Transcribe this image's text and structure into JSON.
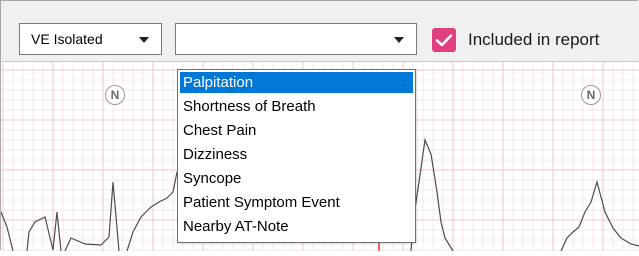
{
  "toolbar": {
    "beat_type_select": {
      "value": "VE Isolated"
    },
    "symptom_select": {
      "value": ""
    },
    "include_checkbox": {
      "checked": true,
      "label": "Included in report"
    }
  },
  "ecg": {
    "beat_markers": [
      "N",
      "N"
    ]
  },
  "symptom_dropdown": {
    "options": [
      "Palpitation",
      "Shortness of Breath",
      "Chest Pain",
      "Dizziness",
      "Syncope",
      "Patient Symptom Event",
      "Nearby AT-Note"
    ],
    "highlighted": "Palpitation"
  },
  "colors": {
    "grid": "#f2c9c9",
    "trace": "#4d4d4d",
    "accent": "#e0407e",
    "highlight": "#0078d7",
    "marker_line": "#e03030"
  }
}
